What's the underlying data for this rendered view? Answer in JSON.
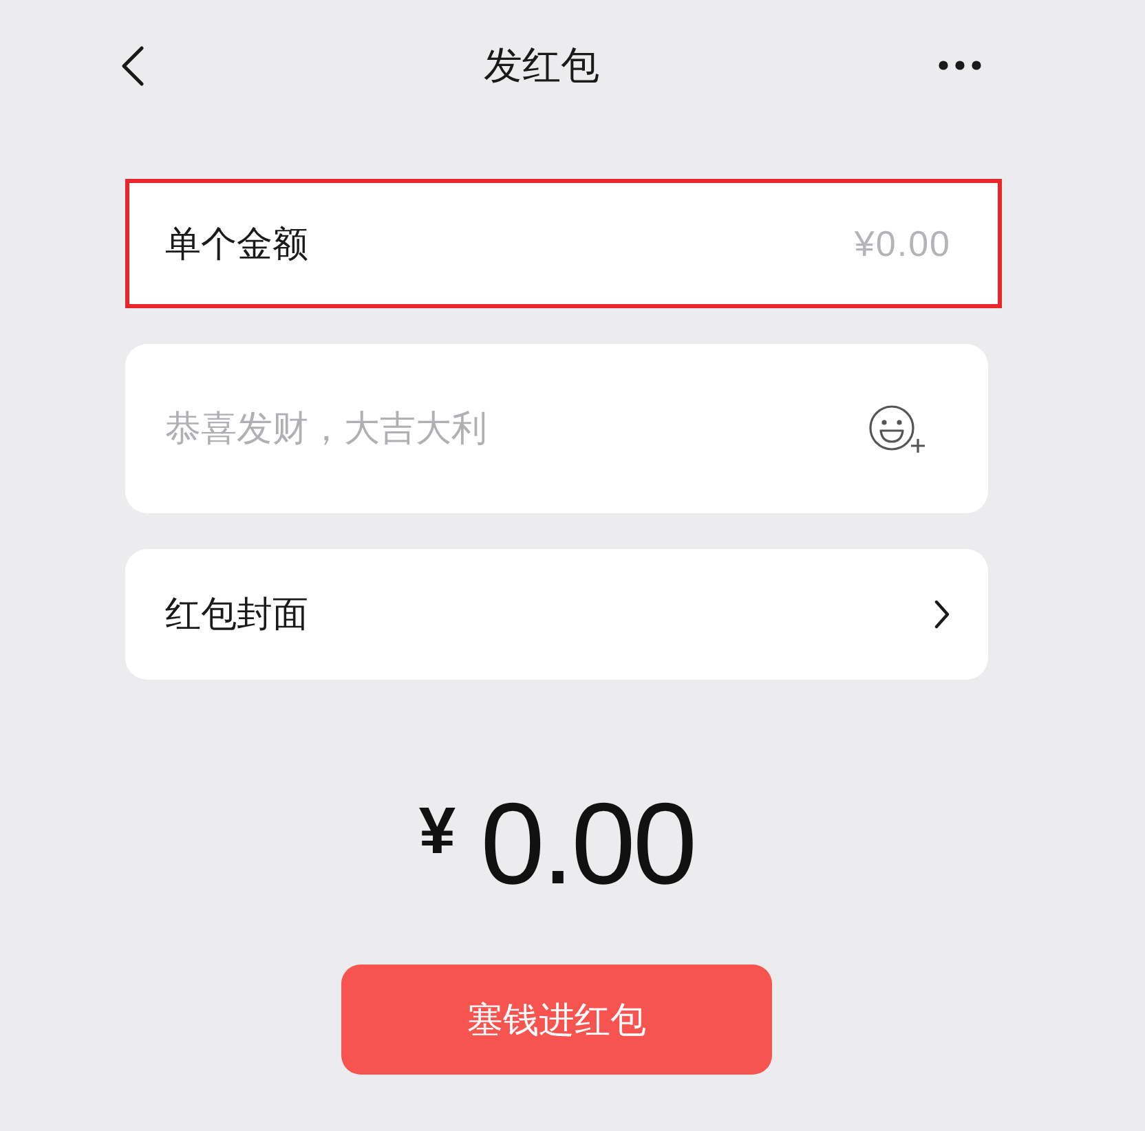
{
  "header": {
    "title": "发红包"
  },
  "fields": [
    {
      "kind": "amount",
      "label": "单个金额",
      "placeholder": "¥0.00",
      "highlighted": true
    },
    {
      "kind": "message",
      "placeholder": "恭喜发财，大吉大利",
      "highlighted": false
    },
    {
      "kind": "cover",
      "label": "红包封面",
      "highlighted": false
    }
  ],
  "total": {
    "currency": "¥",
    "amount": "0.00"
  },
  "submit_button": {
    "label": "塞钱进红包"
  }
}
